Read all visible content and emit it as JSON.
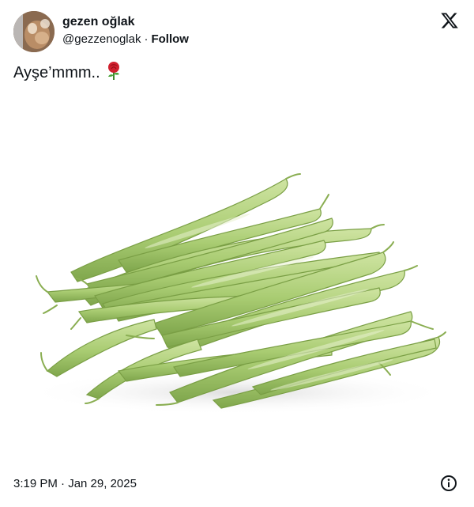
{
  "author": {
    "display_name": "gezen oğlak",
    "handle": "@gezzenoglak",
    "separator": "·",
    "follow_label": "Follow",
    "avatar_icon": "avatar-photo"
  },
  "brand": {
    "logo_icon": "x-logo-icon"
  },
  "tweet": {
    "text": "Ayşe’mmm..",
    "emoji_icon": "rose-emoji"
  },
  "media": {
    "subject": "green-beans-photo",
    "background": "#ffffff"
  },
  "footer": {
    "timestamp": "3:19 PM · Jan 29, 2025",
    "info_icon": "info-icon"
  },
  "colors": {
    "text": "#0f1419",
    "bean_light": "#c9e09a",
    "bean_mid": "#a9cc72",
    "bean_dark": "#86ad52"
  }
}
